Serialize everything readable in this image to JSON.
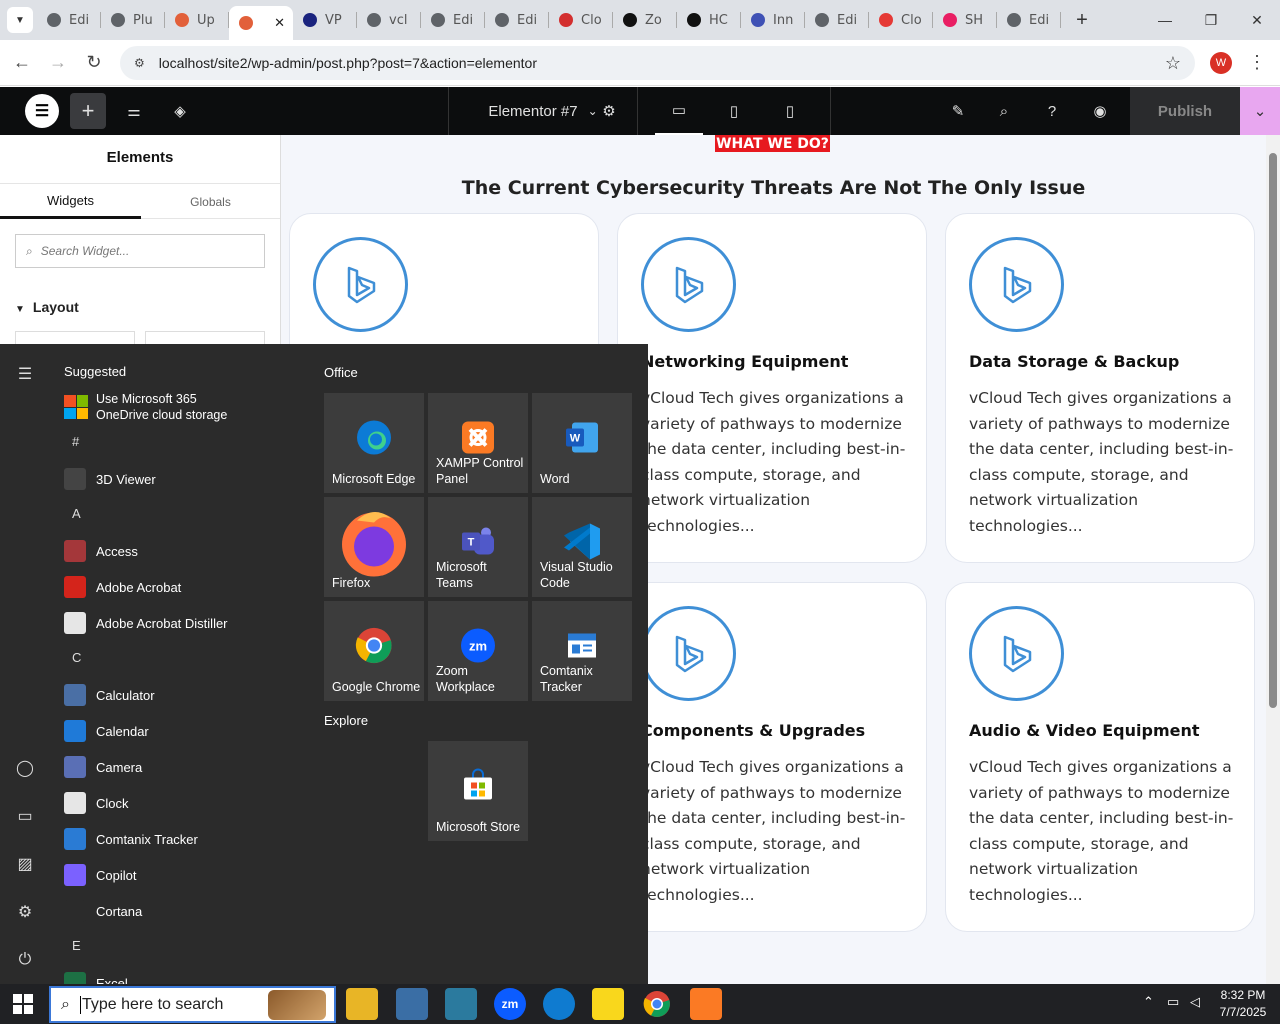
{
  "browser": {
    "tabs": [
      {
        "label": "Edi",
        "color": "#5f6368"
      },
      {
        "label": "Plu",
        "color": "#5f6368"
      },
      {
        "label": "Up",
        "color": "#e2603a"
      },
      {
        "label": "",
        "color": "#e2603a",
        "active": true
      },
      {
        "label": "VP",
        "color": "#1a237e"
      },
      {
        "label": "vcl",
        "color": "#5f6368"
      },
      {
        "label": "Edi",
        "color": "#5f6368"
      },
      {
        "label": "Edi",
        "color": "#5f6368"
      },
      {
        "label": "Clo",
        "color": "#d32f2f"
      },
      {
        "label": "Zo",
        "color": "#111111"
      },
      {
        "label": "HC",
        "color": "#111111"
      },
      {
        "label": "Inn",
        "color": "#3f51b5"
      },
      {
        "label": "Edi",
        "color": "#5f6368"
      },
      {
        "label": "Clo",
        "color": "#e53935"
      },
      {
        "label": "SH",
        "color": "#e91e63"
      },
      {
        "label": "Edi",
        "color": "#5f6368"
      }
    ],
    "url": "localhost/site2/wp-admin/post.php?post=7&action=elementor",
    "profile_initial": "W"
  },
  "elementor": {
    "doc_title": "Elementor #7",
    "publish_label": "Publish",
    "panel_title": "Elements",
    "tabs": [
      "Widgets",
      "Globals"
    ],
    "search_placeholder": "Search Widget...",
    "section_label": "Layout"
  },
  "canvas": {
    "badge": "WHAT WE DO?",
    "heading": "The Current Cybersecurity Threats Are Not The Only Issue",
    "cards": [
      {
        "title": "",
        "text": ""
      },
      {
        "title": "Networking Equipment",
        "text": "vCloud Tech gives organizations a variety of pathways to modernize the data center, including best-in-class compute, storage, and network virtualization technologies..."
      },
      {
        "title": "Data Storage & Backup",
        "text": "vCloud Tech gives organizations a variety of pathways to modernize the data center, including best-in-class compute, storage, and network virtualization technologies..."
      },
      {
        "title": "Components & Upgrades",
        "text": "vCloud Tech gives organizations a variety of pathways to modernize the data center, including best-in-class compute, storage, and network virtualization technologies..."
      },
      {
        "title": "Audio & Video Equipment",
        "text": "vCloud Tech gives organizations a variety of pathways to modernize the data center, including best-in-class compute, storage, and network virtualization technologies..."
      }
    ]
  },
  "start_menu": {
    "suggested_label": "Suggested",
    "suggested_item_line1": "Use Microsoft 365",
    "suggested_item_line2": "OneDrive cloud storage",
    "apps": [
      {
        "type": "letter",
        "text": "#"
      },
      {
        "type": "app",
        "text": "3D Viewer",
        "icon": "cube-icon",
        "color": "#444"
      },
      {
        "type": "letter",
        "text": "A"
      },
      {
        "type": "app",
        "text": "Access",
        "icon": "access-icon",
        "color": "#a4373a"
      },
      {
        "type": "app",
        "text": "Adobe Acrobat",
        "icon": "acrobat-icon",
        "color": "#d4241b"
      },
      {
        "type": "app",
        "text": "Adobe Acrobat Distiller",
        "icon": "distiller-icon",
        "color": "#e6e6e6"
      },
      {
        "type": "letter",
        "text": "C"
      },
      {
        "type": "app",
        "text": "Calculator",
        "icon": "calculator-icon",
        "color": "#4a6fa5"
      },
      {
        "type": "app",
        "text": "Calendar",
        "icon": "calendar-icon",
        "color": "#1f7ad8"
      },
      {
        "type": "app",
        "text": "Camera",
        "icon": "camera-icon",
        "color": "#5a6fb5"
      },
      {
        "type": "app",
        "text": "Clock",
        "icon": "clock-icon",
        "color": "#e6e6e6"
      },
      {
        "type": "app",
        "text": "Comtanix Tracker",
        "icon": "comtanix-icon",
        "color": "#2a7bd4"
      },
      {
        "type": "app",
        "text": "Copilot",
        "icon": "copilot-icon",
        "color": "#7b61ff"
      },
      {
        "type": "app",
        "text": "Cortana",
        "icon": "cortana-icon",
        "color": "#2b2b2b"
      },
      {
        "type": "letter",
        "text": "E"
      },
      {
        "type": "app",
        "text": "Excel",
        "icon": "excel-icon",
        "color": "#1d7044"
      }
    ],
    "office_label": "Office",
    "explore_label": "Explore",
    "tiles": [
      {
        "line1": "Microsoft Edge",
        "line2": "",
        "icon": "edge-icon"
      },
      {
        "line1": "XAMPP Control",
        "line2": "Panel",
        "icon": "xampp-icon"
      },
      {
        "line1": "Word",
        "line2": "",
        "icon": "word-icon"
      },
      {
        "line1": "Firefox",
        "line2": "",
        "icon": "firefox-icon"
      },
      {
        "line1": "Microsoft",
        "line2": "Teams",
        "icon": "teams-icon"
      },
      {
        "line1": "Visual Studio",
        "line2": "Code",
        "icon": "vscode-icon"
      },
      {
        "line1": "Google Chrome",
        "line2": "",
        "icon": "chrome-icon"
      },
      {
        "line1": "Zoom",
        "line2": "Workplace",
        "icon": "zoom-icon"
      },
      {
        "line1": "Comtanix",
        "line2": "Tracker",
        "icon": "comtanix-icon"
      }
    ],
    "explore_tile": {
      "line1": "Microsoft Store",
      "icon": "store-icon"
    }
  },
  "taskbar": {
    "search_placeholder": "Type here to search",
    "time": "8:32 PM",
    "date": "7/7/2025"
  }
}
